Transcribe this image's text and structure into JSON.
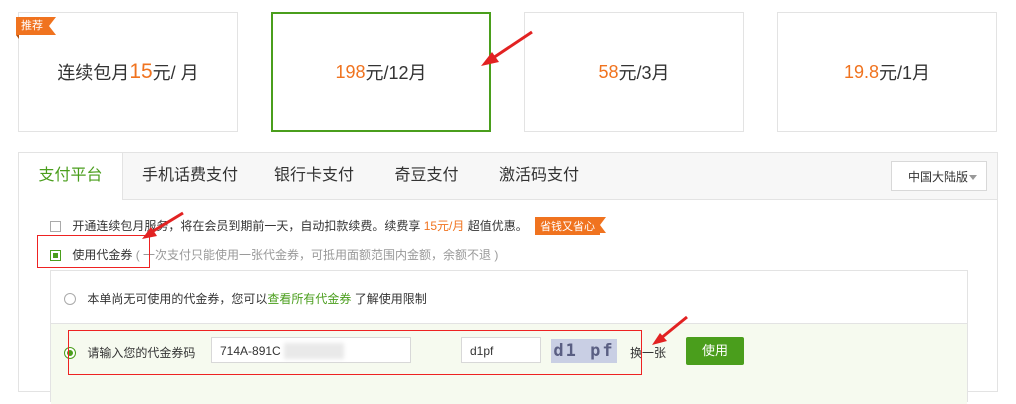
{
  "plans": [
    {
      "badge": "推荐",
      "prefix": "连续包月 ",
      "price": "15",
      "suffix": "元/ 月"
    },
    {
      "price": "198",
      "suffix": "元/12月"
    },
    {
      "price": "58",
      "suffix": "元/3月"
    },
    {
      "price": "19.8",
      "suffix": "元/1月"
    }
  ],
  "tabs": [
    "支付平台",
    "手机话费支付",
    "银行卡支付",
    "奇豆支付",
    "激活码支付"
  ],
  "region": "中国大陆版",
  "autorenew": {
    "text": "开通连续包月服务，将在会员到期前一天，自动扣款续费。续费享 ",
    "price": "15元/月",
    "after": " 超值优惠。",
    "tag": "省钱又省心"
  },
  "voucher": {
    "label": "使用代金券",
    "hint": "( 一次支付只能使用一张代金券，可抵用面额范围内金额，余额不退 )",
    "none_text": "本单尚无可使用的代金券，您可以",
    "none_link": "查看所有代金券",
    "none_after": " 了解使用限制",
    "enter_label": "请输入您的代金券码",
    "code_value": "714A-891C",
    "captcha_value": "d1pf",
    "captcha_image_text": "d1 pf",
    "refresh": "换一张",
    "use_button": "使用"
  },
  "colors": {
    "accent": "#4a9e1c",
    "price": "#f0731f",
    "annotation": "#e22222"
  }
}
